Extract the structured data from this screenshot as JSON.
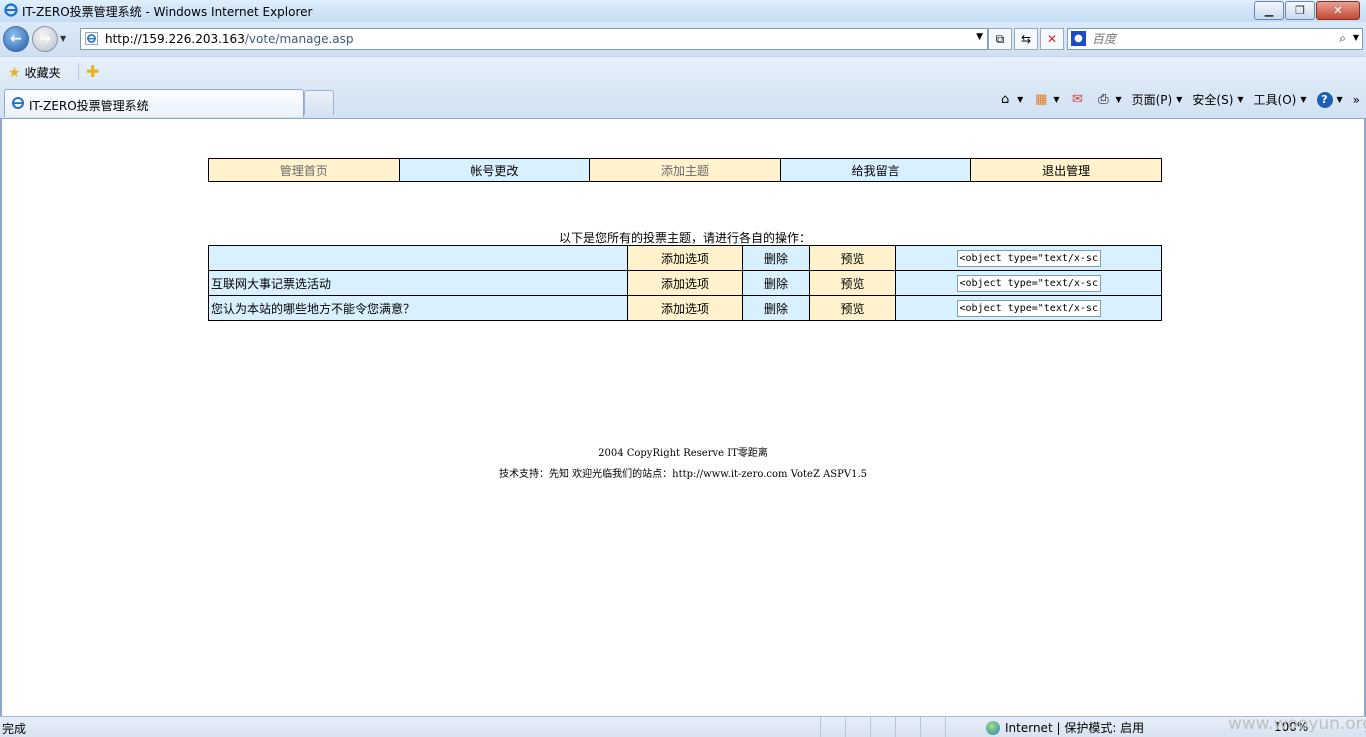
{
  "window": {
    "title": "IT-ZERO投票管理系统 - Windows Internet Explorer"
  },
  "addressbar": {
    "url_host": "http://159.226.203.163",
    "url_path": "/vote/manage.asp",
    "search_placeholder": "百度"
  },
  "favorites": {
    "label": "收藏夹"
  },
  "tab": {
    "label": "IT-ZERO投票管理系统"
  },
  "commandbar": {
    "page": "页面(P)",
    "safety": "安全(S)",
    "tools": "工具(O)"
  },
  "nav": [
    {
      "label": "管理首页",
      "bg": "#fff2cc",
      "dim": true
    },
    {
      "label": "帐号更改",
      "bg": "#d9f0ff",
      "dim": false
    },
    {
      "label": "添加主题",
      "bg": "#fff2cc",
      "dim": true
    },
    {
      "label": "给我留言",
      "bg": "#d9f0ff",
      "dim": false
    },
    {
      "label": "退出管理",
      "bg": "#fff2cc",
      "dim": false
    }
  ],
  "caption": "以下是您所有的投票主题，请进行各自的操作：",
  "votes": [
    {
      "title": "",
      "add": "添加选项",
      "del": "删除",
      "preview": "预览",
      "code": "<object type=\"text/x-scriptlet\""
    },
    {
      "title": "互联网大事记票选活动",
      "add": "添加选项",
      "del": "删除",
      "preview": "预览",
      "code": "<object type=\"text/x-scriptlet\""
    },
    {
      "title": "您认为本站的哪些地方不能令您满意？",
      "add": "添加选项",
      "del": "删除",
      "preview": "预览",
      "code": "<object type=\"text/x-scriptlet\""
    }
  ],
  "footer": {
    "line1": "2004 CopyRight Reserve IT零距离",
    "line2": "技术支持：先知 欢迎光临我们的站点：http://www.it-zero.com VoteZ ASPV1.5"
  },
  "statusbar": {
    "status": "完成",
    "zone": "Internet | 保护模式: 启用",
    "zoom": "100%"
  },
  "watermark": "www.wooyun.org",
  "colors": {
    "yellow_cell": "#fff2cc",
    "blue_cell": "#d9f0ff"
  }
}
